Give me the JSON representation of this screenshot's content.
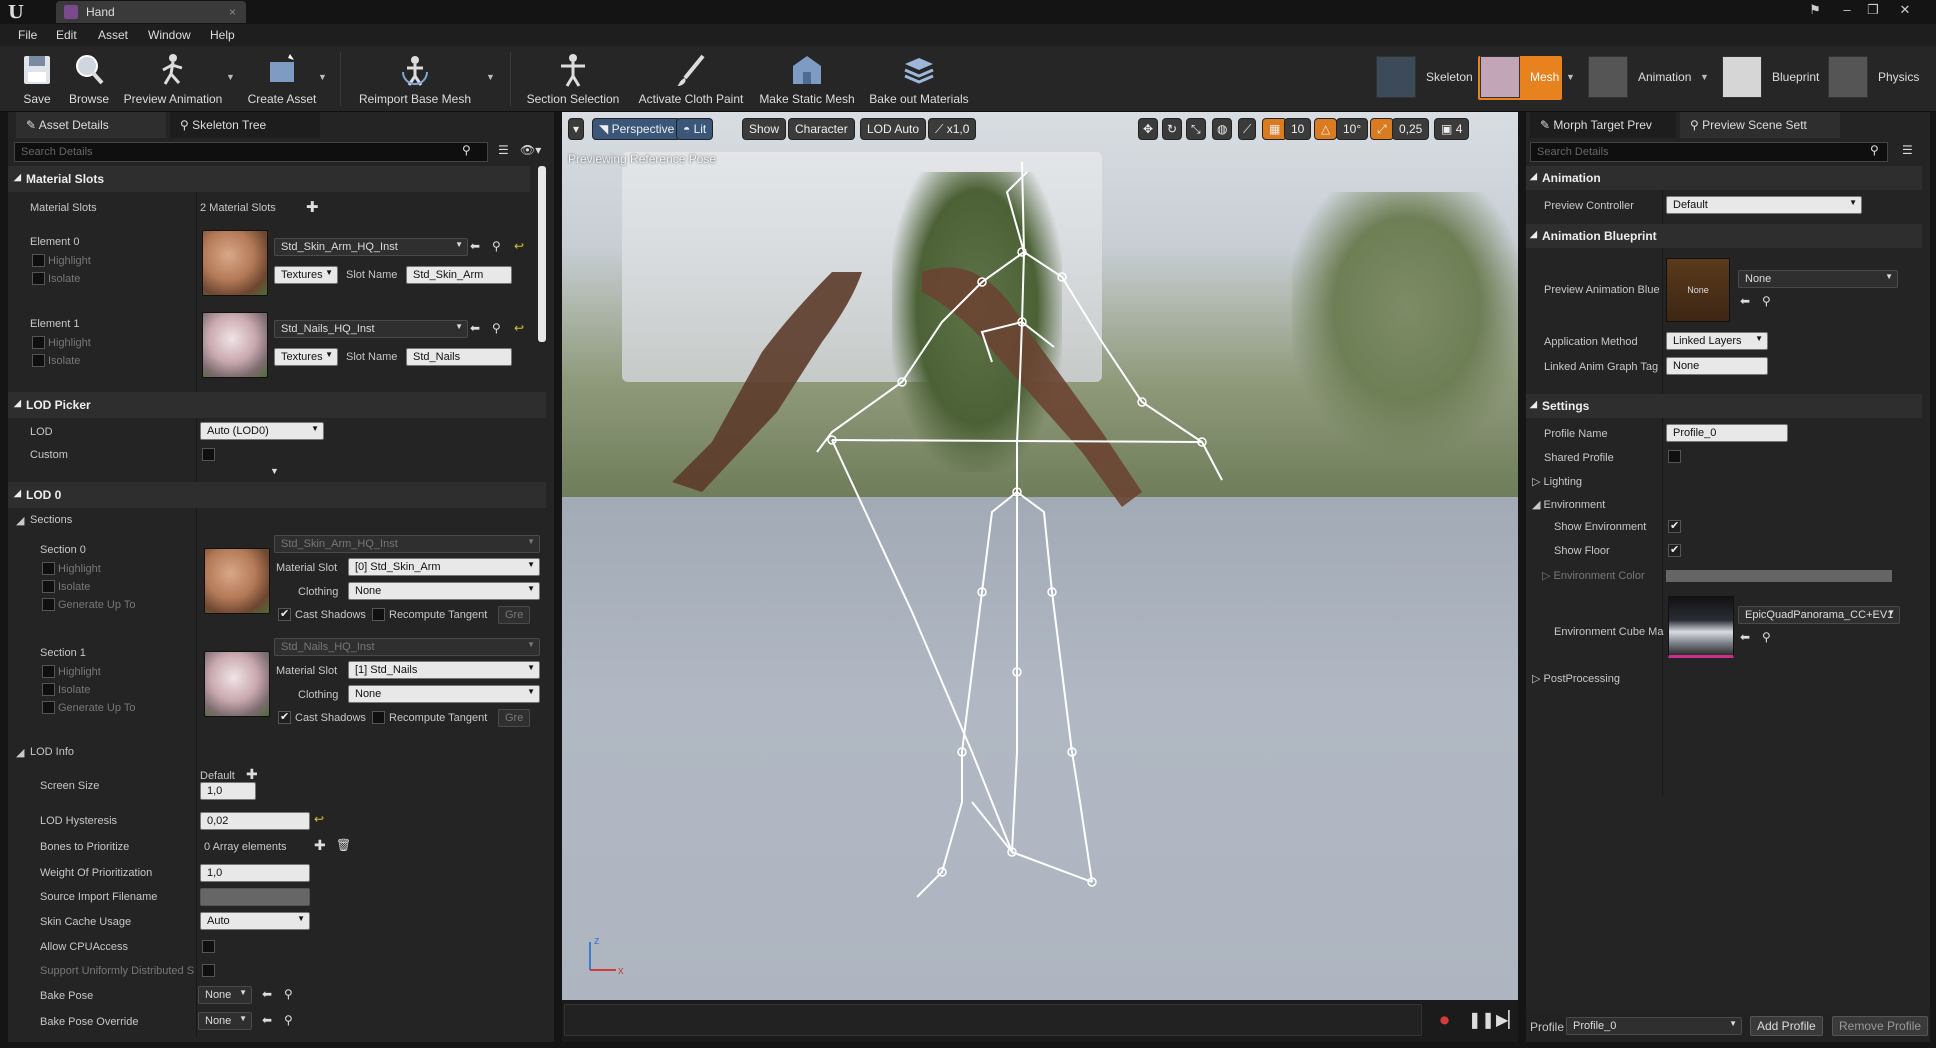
{
  "window": {
    "tab_title": "Hand"
  },
  "menu": [
    "File",
    "Edit",
    "Asset",
    "Window",
    "Help"
  ],
  "toolbar": {
    "buttons": [
      "Save",
      "Browse",
      "Preview Animation",
      "Create Asset",
      "Reimport Base Mesh",
      "Section Selection",
      "Activate Cloth Paint",
      "Make Static Mesh",
      "Bake out Materials"
    ],
    "modes": [
      "Skeleton",
      "Mesh",
      "Animation",
      "Blueprint",
      "Physics"
    ]
  },
  "left": {
    "tabs": [
      "Asset Details",
      "Skeleton Tree"
    ],
    "search_placeholder": "Search Details",
    "material_slots": {
      "header": "Material Slots",
      "label": "Material Slots",
      "count": "2 Material Slots",
      "elements": [
        {
          "name": "Element 0",
          "material": "Std_Skin_Arm_HQ_Inst",
          "textures": "Textures",
          "slot_label": "Slot Name",
          "slot": "Std_Skin_Arm"
        },
        {
          "name": "Element 1",
          "material": "Std_Nails_HQ_Inst",
          "textures": "Textures",
          "slot_label": "Slot Name",
          "slot": "Std_Nails"
        }
      ],
      "highlight": "Highlight",
      "isolate": "Isolate"
    },
    "lod_picker": {
      "header": "LOD Picker",
      "lod_label": "LOD",
      "lod_value": "Auto (LOD0)",
      "custom_label": "Custom"
    },
    "lod0": {
      "header": "LOD 0",
      "sections_label": "Sections",
      "sections": [
        {
          "name": "Section 0",
          "material": "Std_Skin_Arm_HQ_Inst",
          "slot": "[0] Std_Skin_Arm",
          "clothing": "None"
        },
        {
          "name": "Section 1",
          "material": "Std_Nails_HQ_Inst",
          "slot": "[1] Std_Nails",
          "clothing": "None"
        }
      ],
      "generate_up_to": "Generate Up To",
      "material_slot_label": "Material Slot",
      "clothing_label": "Clothing",
      "cast_shadows": "Cast Shadows",
      "recompute_tangent": "Recompute Tangent",
      "gre": "Gre"
    },
    "lod_info": {
      "header": "LOD Info",
      "default_label": "Default",
      "screen_size_label": "Screen Size",
      "screen_size": "1,0",
      "hysteresis_label": "LOD Hysteresis",
      "hysteresis": "0,02",
      "bones_label": "Bones to Prioritize",
      "bones_value": "0 Array elements",
      "weight_label": "Weight Of Prioritization",
      "weight": "1,0",
      "source_label": "Source Import Filename",
      "skin_cache_label": "Skin Cache Usage",
      "skin_cache": "Auto",
      "cpu_label": "Allow CPUAccess",
      "support_label": "Support Uniformly Distributed S",
      "bake_pose_label": "Bake Pose",
      "bake_pose": "None",
      "bake_override_label": "Bake Pose Override",
      "bake_override": "None"
    }
  },
  "viewport": {
    "perspective": "Perspective",
    "lit": "Lit",
    "show": "Show",
    "character": "Character",
    "lod": "LOD Auto",
    "speed": "x1,0",
    "grid": "10",
    "angle": "10°",
    "scale": "0,25",
    "cam": "4",
    "status": "Previewing Reference Pose",
    "axis_x": "x",
    "axis_z": "z"
  },
  "right": {
    "tabs": [
      "Morph Target Prev",
      "Preview Scene Sett"
    ],
    "search_placeholder": "Search Details",
    "animation": {
      "header": "Animation",
      "controller_label": "Preview Controller",
      "controller": "Default"
    },
    "anim_bp": {
      "header": "Animation Blueprint",
      "preview_label": "Preview Animation Blue",
      "preview_value": "None",
      "thumb": "None",
      "method_label": "Application Method",
      "method": "Linked Layers",
      "tag_label": "Linked Anim Graph Tag",
      "tag": "None"
    },
    "settings": {
      "header": "Settings",
      "profile_name_label": "Profile Name",
      "profile_name": "Profile_0",
      "shared_label": "Shared Profile",
      "lighting": "Lighting",
      "environment": "Environment",
      "show_env": "Show Environment",
      "show_floor": "Show Floor",
      "env_color": "Environment Color",
      "cube_label": "Environment Cube Ma",
      "cube_value": "EpicQuadPanorama_CC+EV1",
      "post": "PostProcessing"
    },
    "footer": {
      "profile_label": "Profile",
      "profile": "Profile_0",
      "add": "Add Profile",
      "remove": "Remove Profile"
    }
  },
  "colors": {
    "accent_mesh": "#e8821e",
    "selection_blue": "#3a5678"
  }
}
